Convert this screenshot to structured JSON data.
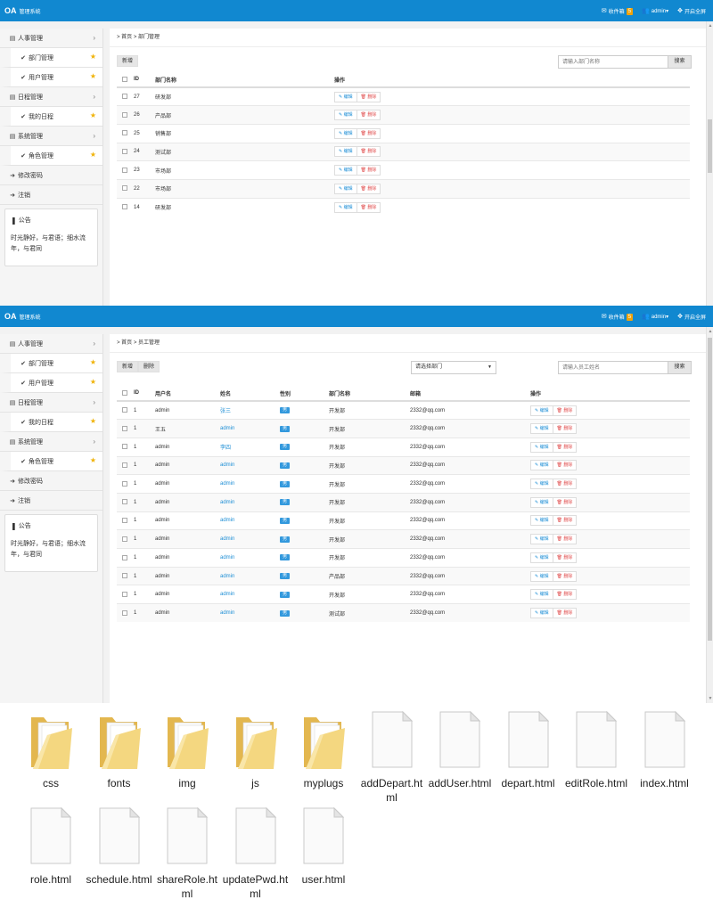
{
  "app": {
    "brand": "OA",
    "subtitle": "管理系统",
    "inbox_label": "收件箱",
    "inbox_count": "5",
    "user": "admin▾",
    "fullscreen": "开启全屏"
  },
  "sidebar": {
    "items": [
      {
        "label": "人事管理",
        "type": "group"
      },
      {
        "label": "部门管理",
        "type": "sub"
      },
      {
        "label": "用户管理",
        "type": "sub"
      },
      {
        "label": "日程管理",
        "type": "group"
      },
      {
        "label": "我的日程",
        "type": "sub"
      },
      {
        "label": "系统管理",
        "type": "group"
      },
      {
        "label": "角色管理",
        "type": "sub"
      },
      {
        "label": "修改密码",
        "type": "action"
      },
      {
        "label": "注销",
        "type": "action"
      }
    ],
    "notice_title": "公告",
    "notice_body": "时光静好，与君语；细水流年，与君同"
  },
  "depart": {
    "breadcrumb": "> 首页 > 部门管理",
    "add_button": "新增",
    "search_placeholder": "请输入部门名称",
    "search_button": "搜索",
    "columns": [
      "ID",
      "部门名称",
      "操作"
    ],
    "edit_label": "编辑",
    "delete_label": "删除",
    "rows": [
      {
        "id": "27",
        "name": "研发部"
      },
      {
        "id": "26",
        "name": "产品部"
      },
      {
        "id": "25",
        "name": "销售部"
      },
      {
        "id": "24",
        "name": "测试部"
      },
      {
        "id": "23",
        "name": "市场部"
      },
      {
        "id": "22",
        "name": "市场部"
      },
      {
        "id": "14",
        "name": "研发部"
      }
    ]
  },
  "user": {
    "breadcrumb": "> 首页 > 员工管理",
    "add_button": "新增",
    "delete_button": "删除",
    "select_value": "请选择部门",
    "search_placeholder": "请输入员工姓名",
    "search_button": "搜索",
    "columns": [
      "ID",
      "用户名",
      "姓名",
      "性别",
      "部门名称",
      "邮箱",
      "操作"
    ],
    "edit_label": "编辑",
    "delete_label": "删除",
    "rows": [
      {
        "id": "1",
        "username": "admin",
        "name": "张三",
        "gender": "男",
        "dept": "开发部",
        "email": "2332@qq.com"
      },
      {
        "id": "1",
        "username": "王五",
        "name": "admin",
        "gender": "男",
        "dept": "开发部",
        "email": "2332@qq.com"
      },
      {
        "id": "1",
        "username": "admin",
        "name": "李四",
        "gender": "男",
        "dept": "开发部",
        "email": "2332@qq.com"
      },
      {
        "id": "1",
        "username": "admin",
        "name": "admin",
        "gender": "男",
        "dept": "开发部",
        "email": "2332@qq.com"
      },
      {
        "id": "1",
        "username": "admin",
        "name": "admin",
        "gender": "男",
        "dept": "开发部",
        "email": "2332@qq.com"
      },
      {
        "id": "1",
        "username": "admin",
        "name": "admin",
        "gender": "男",
        "dept": "开发部",
        "email": "2332@qq.com"
      },
      {
        "id": "1",
        "username": "admin",
        "name": "admin",
        "gender": "男",
        "dept": "开发部",
        "email": "2332@qq.com"
      },
      {
        "id": "1",
        "username": "admin",
        "name": "admin",
        "gender": "男",
        "dept": "开发部",
        "email": "2332@qq.com"
      },
      {
        "id": "1",
        "username": "admin",
        "name": "admin",
        "gender": "男",
        "dept": "开发部",
        "email": "2332@qq.com"
      },
      {
        "id": "1",
        "username": "admin",
        "name": "admin",
        "gender": "男",
        "dept": "产品部",
        "email": "2332@qq.com"
      },
      {
        "id": "1",
        "username": "admin",
        "name": "admin",
        "gender": "男",
        "dept": "开发部",
        "email": "2332@qq.com"
      },
      {
        "id": "1",
        "username": "admin",
        "name": "admin",
        "gender": "男",
        "dept": "测试部",
        "email": "2332@qq.com"
      }
    ]
  },
  "files": [
    {
      "name": "css",
      "kind": "folder"
    },
    {
      "name": "fonts",
      "kind": "folder"
    },
    {
      "name": "img",
      "kind": "folder"
    },
    {
      "name": "js",
      "kind": "folder"
    },
    {
      "name": "myplugs",
      "kind": "folder"
    },
    {
      "name": "addDepart.html",
      "kind": "file"
    },
    {
      "name": "addUser.html",
      "kind": "file"
    },
    {
      "name": "depart.html",
      "kind": "file"
    },
    {
      "name": "editRole.html",
      "kind": "file"
    },
    {
      "name": "index.html",
      "kind": "file"
    },
    {
      "name": "role.html",
      "kind": "file"
    },
    {
      "name": "schedule.html",
      "kind": "file"
    },
    {
      "name": "shareRole.html",
      "kind": "file"
    },
    {
      "name": "updatePwd.html",
      "kind": "file"
    },
    {
      "name": "user.html",
      "kind": "file"
    }
  ],
  "colors": {
    "topbar": "#1188d0",
    "accent": "#1f8fd6",
    "star": "#f0b30a",
    "danger": "#e04b4b",
    "badge": "#f0a30a"
  }
}
